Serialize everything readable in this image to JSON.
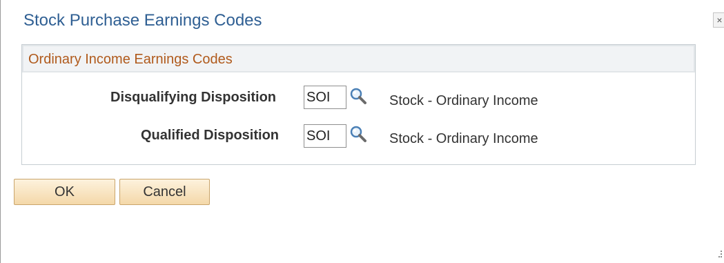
{
  "modal": {
    "title": "Stock Purchase Earnings Codes",
    "close_glyph": "×"
  },
  "group": {
    "title": "Ordinary Income Earnings Codes"
  },
  "fields": [
    {
      "label": "Disqualifying Disposition",
      "value": "SOI",
      "description": "Stock - Ordinary Income",
      "icon": "lookup-magnifier-icon"
    },
    {
      "label": "Qualified Disposition",
      "value": "SOI",
      "description": "Stock - Ordinary Income",
      "icon": "lookup-magnifier-icon"
    }
  ],
  "buttons": {
    "ok_label": "OK",
    "cancel_label": "Cancel"
  },
  "colors": {
    "title": "#2f5f93",
    "group_title": "#b05a1c",
    "button_top": "#fdf2dd",
    "button_bottom": "#f4d8a9",
    "button_border": "#c9a46a"
  }
}
